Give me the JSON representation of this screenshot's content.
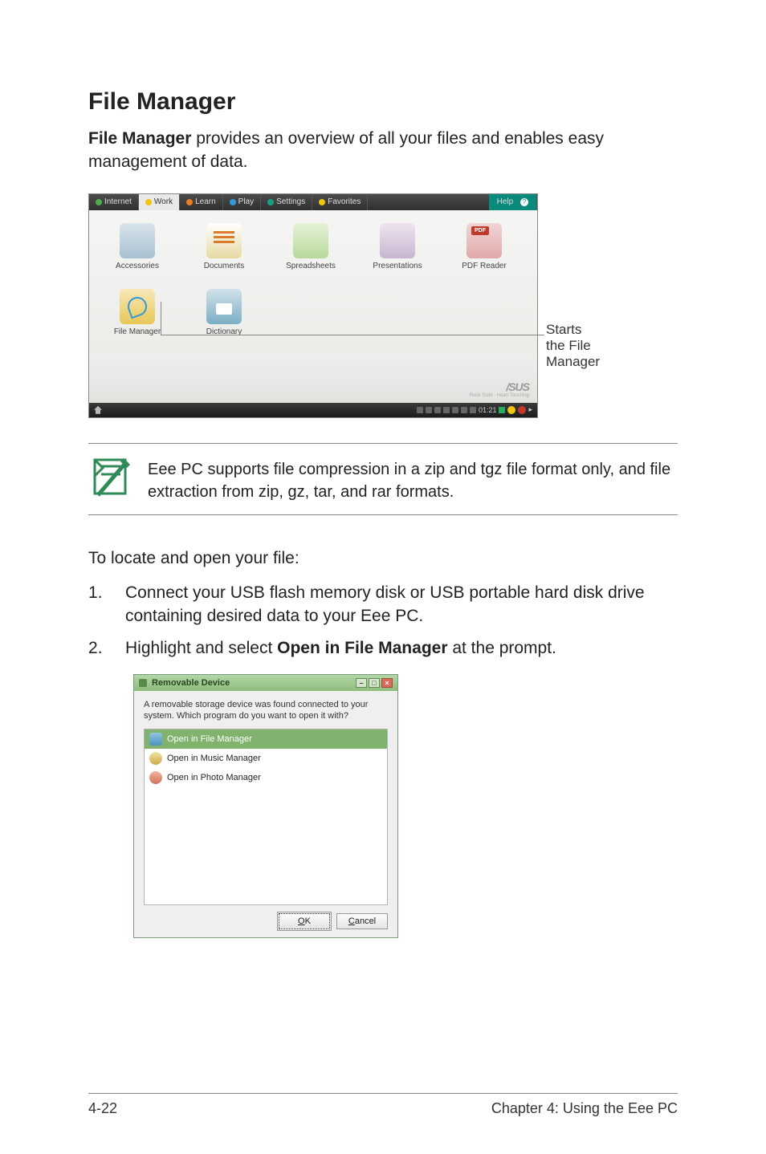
{
  "heading": "File Manager",
  "intro": {
    "lead": "File Manager",
    "rest": " provides an overview of all your files and enables easy management of data."
  },
  "os": {
    "tabs": {
      "internet": "Internet",
      "work": "Work",
      "learn": "Learn",
      "play": "Play",
      "settings": "Settings",
      "favorites": "Favorites",
      "help": "Help"
    },
    "launchers": {
      "accessories": "Accessories",
      "documents": "Documents",
      "spreadsheets": "Spreadsheets",
      "presentations": "Presentations",
      "pdf": "PDF Reader",
      "filemanager": "File Manager",
      "dictionary": "Dictionary"
    },
    "logo": "/SUS",
    "logo_sub": "Rock Solid · Heart Touching",
    "taskbar_time": "01:21",
    "help_q": "?"
  },
  "callout": {
    "line1": "Starts",
    "line2": "the File",
    "line3": "Manager"
  },
  "note": "Eee PC supports file compression in a zip and tgz file format only, and file extraction from zip, gz, tar, and rar formats.",
  "subhead": "To locate and open your file:",
  "steps": {
    "s1": "Connect your USB flash memory disk or USB portable hard disk drive containing desired data to your Eee PC.",
    "s2_pre": "Highlight and select ",
    "s2_bold": "Open in File Manager",
    "s2_post": " at the prompt."
  },
  "dialog": {
    "title": "Removable Device",
    "message": "A removable storage device was found connected to your system. Which program do you want to open it with?",
    "items": {
      "file": "Open in File Manager",
      "music": "Open in Music Manager",
      "photo": "Open in Photo Manager"
    },
    "ok_u": "O",
    "ok_rest": "K",
    "cancel_u": "C",
    "cancel_rest": "ancel",
    "min": "–",
    "max": "□",
    "close": "×"
  },
  "footer": {
    "left": "4-22",
    "right": "Chapter 4: Using the Eee PC"
  }
}
